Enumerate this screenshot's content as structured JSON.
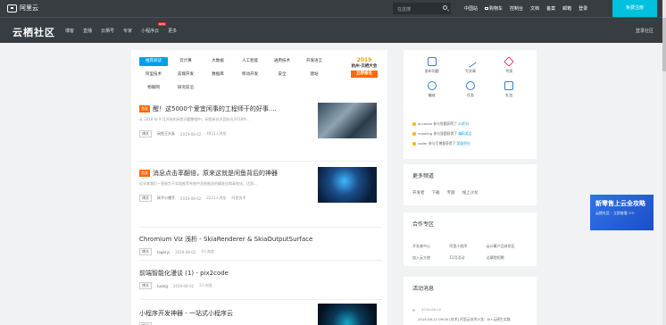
{
  "topbar": {
    "logo": "阿里云",
    "search_placeholder": "在这搜",
    "nav": [
      "中国站",
      "购物车",
      "控制台",
      "文档",
      "备案",
      "邮箱",
      "登录"
    ],
    "signup": "免费注册"
  },
  "subbar": {
    "brand": "云栖社区",
    "nav": [
      "博客",
      "直播",
      "云栖号",
      "专家",
      "小程序云",
      "更多"
    ],
    "nav_new_badge": "NEW",
    "right": "登录社区"
  },
  "tags": [
    "推荐阅读",
    "云计算",
    "大数据",
    "人工智能",
    "通用技术",
    "开发语言",
    "阿里技术",
    "前端开发",
    "数据库",
    "移动开发",
    "安全",
    "建站",
    "物联网",
    "研究前沿"
  ],
  "promo": {
    "year": "2019",
    "title": "杭州·云栖大会",
    "button": "立即报名"
  },
  "articles": [
    {
      "badge": "首发",
      "title": "醒！这5000个爱宜闲事的工程师干的好事....",
      "summary": "从 2018 年 9 月开始的闲鱼问题整理中，闲鱼新技术团队在2018中...",
      "category": "博文",
      "author": "闲鱼王头条",
      "date": "2019-08-02",
      "views": "4921人浏览"
    },
    {
      "badge": "首发",
      "title": "消息点击率翻倍，原来这就是闲鱼背后的神器",
      "summary": "近年来我们一直致力于实现推荐系统中消息推送的精准化和高效化，达到...",
      "category": "博文",
      "author": "砍不小猪手",
      "date": "2019-08-02",
      "views": "2221人浏览",
      "extra": "阿里技术"
    },
    {
      "badge": "",
      "title": "Chromium Viz 浅析 - SkiaRenderer & SkiaOutputSurface",
      "summary": "",
      "category": "博文",
      "author": "rogeryi",
      "date": "2019-08-02",
      "views": "4人浏览"
    },
    {
      "badge": "",
      "title": "前端智能化漫谈 (1) - pix2code",
      "summary": "",
      "category": "博文",
      "author": "lusing",
      "date": "2019-08-02",
      "views": "3人浏览"
    },
    {
      "badge": "",
      "title": "小程序开发神器 - 一站式小程序云",
      "summary": "",
      "category": "推广",
      "author": "",
      "date": "",
      "views": ""
    }
  ],
  "quick": {
    "items": [
      "发布问题",
      "写文章",
      "专家",
      "编成",
      "任务",
      "礼包"
    ],
    "news": [
      {
        "user": "dccanea",
        "text": "参与答题获得了",
        "link": "25积分"
      },
      {
        "user": "crashing",
        "text": "参与答题获得了",
        "link": "编码奖品"
      },
      {
        "user": "coder",
        "text": "参与写博客获得了",
        "link": "奖励积分"
      }
    ]
  },
  "more": {
    "title": "更多频道",
    "links": [
      "开发者",
      "下载",
      "专题",
      "线上沙龙"
    ]
  },
  "coop": {
    "title": "合作专区",
    "links": [
      "开发者中心",
      "阿里小程序",
      "云计算产品体验区",
      "加入云大使",
      "12月活动",
      "达摩院招聘"
    ]
  },
  "events": {
    "title": "活动消息",
    "date": "2019-08-02",
    "item": "2019-08-22 09:00 [技术] 阿里云技术沙龙：AI+云原生实践"
  },
  "float_ad": {
    "title": "新零售上云全攻略",
    "sub": "云栖社区 · 立即查看 >>"
  }
}
